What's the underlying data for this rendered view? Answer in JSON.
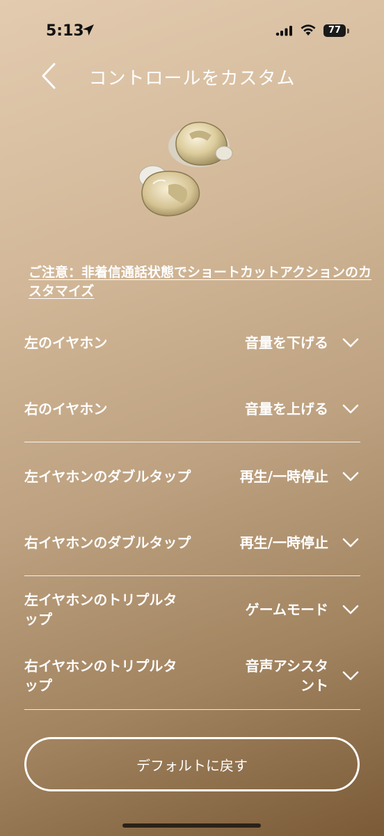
{
  "status_bar": {
    "time": "5:13",
    "battery": "77"
  },
  "header": {
    "title": "コントロールをカスタム"
  },
  "notice": {
    "text": "ご注意：非着信通話状態でショートカットアクションのカスタマイズ"
  },
  "settings": [
    {
      "label": "左のイヤホン",
      "value": "音量を下げる"
    },
    {
      "label": "右のイヤホン",
      "value": "音量を上げる"
    },
    {
      "label": "左イヤホンのダブルタップ",
      "value": "再生/一時停止"
    },
    {
      "label": "右イヤホンのダブルタップ",
      "value": "再生/一時停止"
    },
    {
      "label": "左イヤホンのトリプルタップ",
      "value": "ゲームモード"
    },
    {
      "label": "右イヤホンのトリプルタップ",
      "value": "音声アシスタント"
    }
  ],
  "footer": {
    "reset_label": "デフォルトに戻す"
  }
}
